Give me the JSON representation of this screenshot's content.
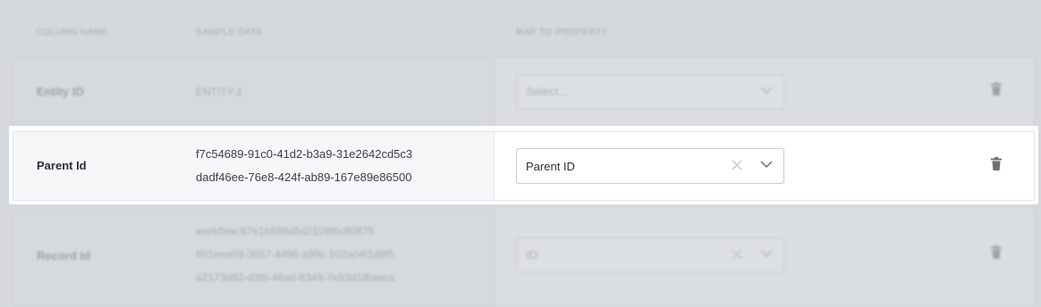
{
  "header": {
    "column_name": "COLUMN NAME",
    "sample_data": "SAMPLE DATA",
    "map_to_property": "MAP TO PROPERTY"
  },
  "rows": [
    {
      "name": "Entity ID",
      "samples": [
        "ENTITY-1"
      ],
      "select": {
        "value": "Select...",
        "placeholder": true,
        "clearable": false
      }
    },
    {
      "name": "Parent Id",
      "samples": [
        "f7c54689-91c0-41d2-b3a9-31e2642cd5c3",
        "dadf46ee-76e8-424f-ab89-167e89e86500"
      ],
      "select": {
        "value": "Parent ID",
        "placeholder": false,
        "clearable": true
      }
    },
    {
      "name": "Record Id",
      "samples": [
        "workflow:67e1b586a5d2109f6c80ff75",
        "601eea59-3857-4496-a99c-102ac4f1d8f5",
        "a2173d92-d3f6-46ad-8349-7e53d1f6aeca"
      ],
      "select": {
        "value": "ID",
        "placeholder": false,
        "clearable": true
      }
    }
  ],
  "icons": {
    "delete": "trash-icon",
    "dropdown": "chevron-down-icon",
    "clear": "close-icon"
  },
  "colors": {
    "backdrop": "#d5d8dc",
    "focused_row_bg": "#ffffff",
    "text_primary": "#2b2f36",
    "icon_gray": "#6b7078"
  }
}
